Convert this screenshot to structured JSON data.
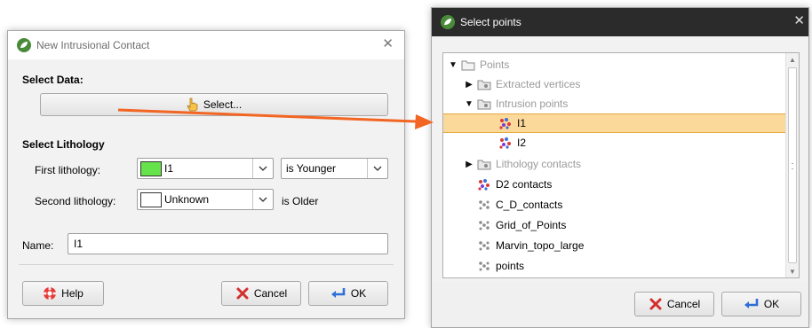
{
  "left_dialog": {
    "title": "New Intrusional Contact",
    "select_data_label": "Select Data:",
    "select_button": "Select...",
    "select_lithology_label": "Select Lithology",
    "first_lithology_label": "First lithology:",
    "first_lithology_value": "I1",
    "first_lithology_color": "#66e34a",
    "relation_value": "is Younger",
    "second_lithology_label": "Second lithology:",
    "second_lithology_value": "Unknown",
    "second_lithology_color": "#ffffff",
    "is_older_label": "is Older",
    "name_label": "Name:",
    "name_value": "I1",
    "help_button": "Help",
    "cancel_button": "Cancel",
    "ok_button": "OK"
  },
  "right_dialog": {
    "title": "Select points",
    "tree": [
      {
        "label": "Points",
        "expander": "expanded",
        "icon": "folder-icon",
        "greyed": true
      },
      {
        "label": "Extracted vertices",
        "expander": "collapsed",
        "icon": "folder-icon",
        "greyed": true
      },
      {
        "label": "Intrusion points",
        "expander": "expanded",
        "icon": "folder-icon",
        "greyed": true
      },
      {
        "label": "I1",
        "icon": "points-icon",
        "selected": true
      },
      {
        "label": "I2",
        "icon": "points-icon"
      },
      {
        "label": "Lithology contacts",
        "expander": "collapsed",
        "icon": "folder-icon",
        "greyed": true
      },
      {
        "label": "D2 contacts",
        "icon": "points-icon"
      },
      {
        "label": "C_D_contacts",
        "icon": "grey-points-icon"
      },
      {
        "label": "Grid_of_Points",
        "icon": "grey-points-icon"
      },
      {
        "label": "Marvin_topo_large",
        "icon": "grey-points-icon"
      },
      {
        "label": "points",
        "icon": "grey-points-icon"
      }
    ],
    "cancel_button": "Cancel",
    "ok_button": "OK"
  },
  "colors": {
    "arrow": "#f26522",
    "selection": "#fbd99b"
  }
}
